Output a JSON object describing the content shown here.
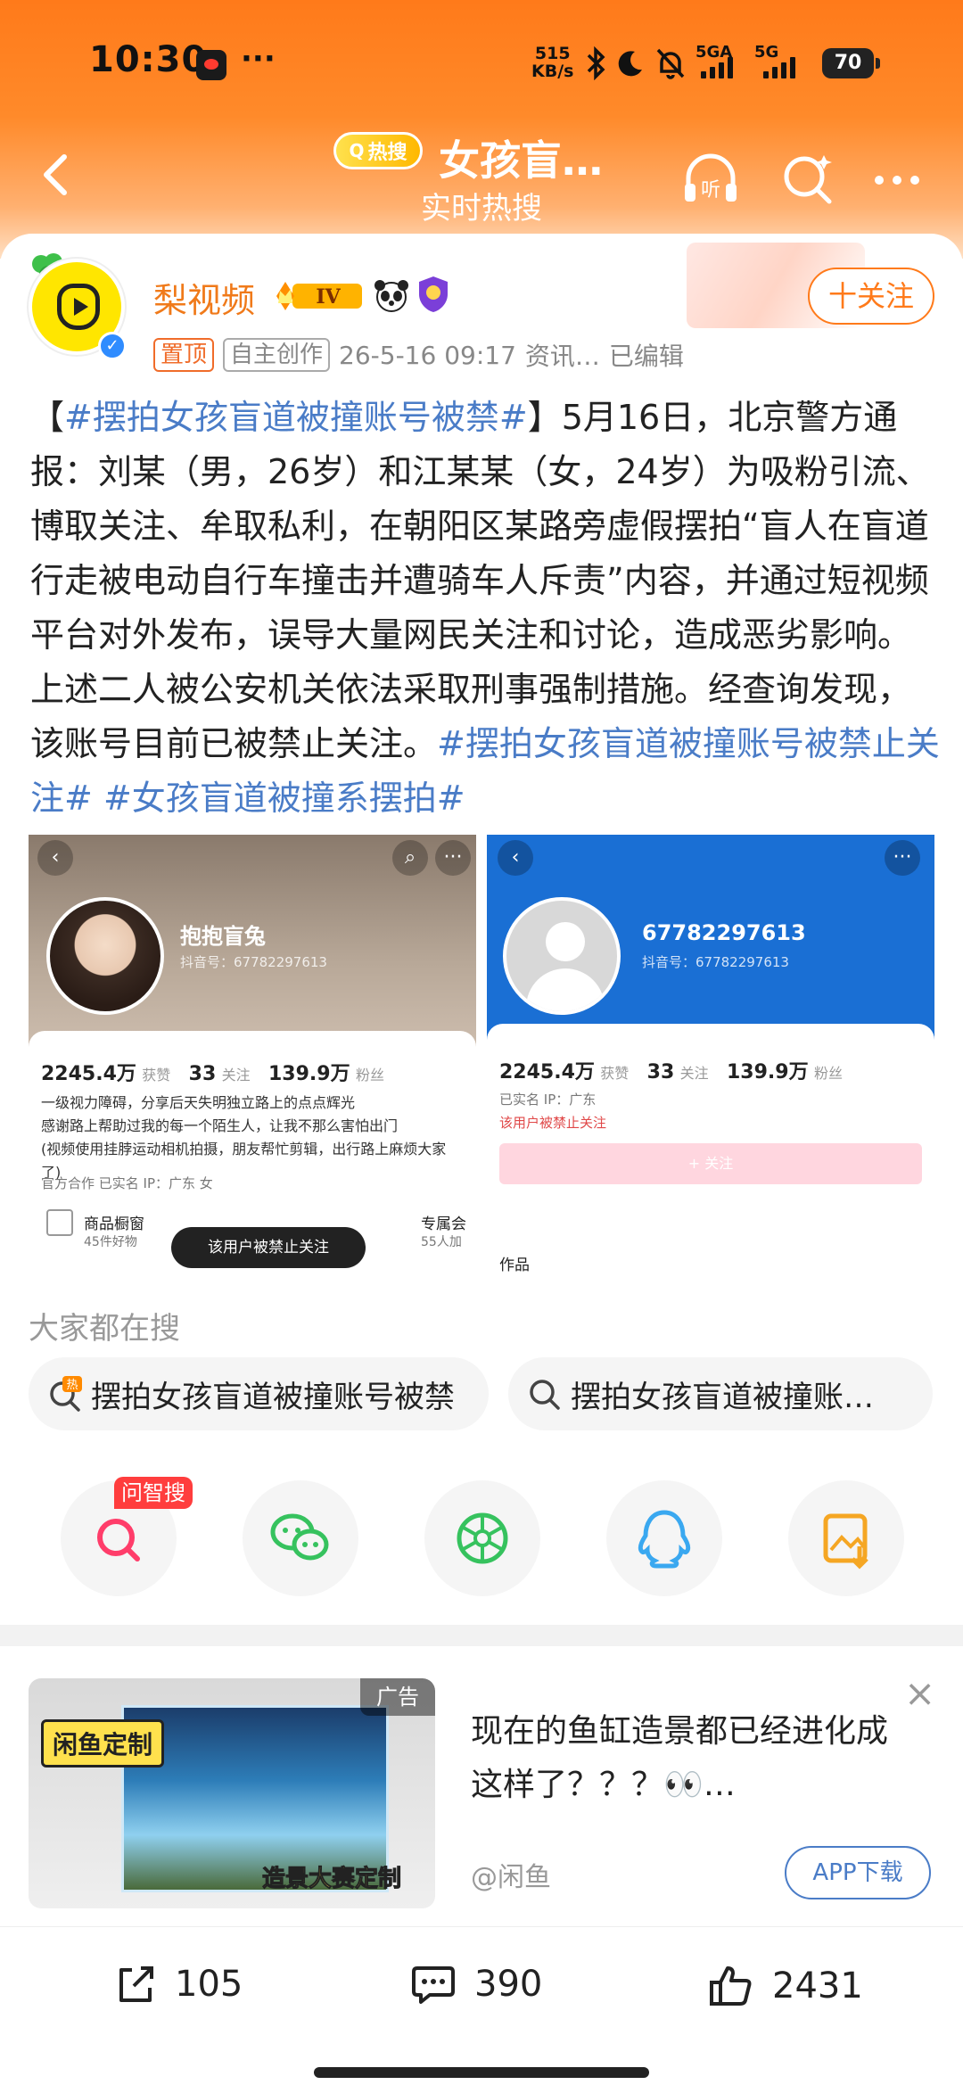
{
  "status_bar": {
    "time": "10:30",
    "more": "···",
    "net_speed_value": "515",
    "net_speed_unit": "KB/s",
    "sim1": "5GA",
    "sim2": "5G",
    "battery": "70"
  },
  "nav": {
    "hot_badge": "热搜",
    "title": "女孩盲…",
    "subtitle": "实时热搜",
    "listen_label": "听"
  },
  "author": {
    "name": "梨视频",
    "level": "IV",
    "tag_top": "置顶",
    "tag_original": "自主创作",
    "time": "26-5-16 09:17",
    "source": "资讯…",
    "edited": "已编辑",
    "follow_label": "十关注"
  },
  "post": {
    "segments": [
      {
        "text": "【",
        "tag": false
      },
      {
        "text": "#摆拍女孩盲道被撞账号被禁#",
        "tag": true
      },
      {
        "text": "】5月16日，北京警方通报：刘某（男，26岁）和江某某（女，24岁）为吸粉引流、博取关注、牟取私利，在朝阳区某路旁虚假摆拍“盲人在盲道行走被电动自行车撞击并遭骑车人斥责”内容，并通过短视频平台对外发布，误导大量网民关注和讨论，造成恶劣影响。上述二人被公安机关依法采取刑事强制措施。经查询发现，该账号目前已被禁止关注。",
        "tag": false
      },
      {
        "text": "#摆拍女孩盲道被撞账号被禁止关注#",
        "tag": true
      },
      {
        "text": " ",
        "tag": false
      },
      {
        "text": "#女孩盲道被撞系摆拍#",
        "tag": true
      }
    ]
  },
  "images": {
    "left": {
      "name": "抱抱盲兔",
      "id": "抖音号：67782297613",
      "likes_num": "2245.4万",
      "likes_label": "获赞",
      "following_num": "33",
      "following_label": "关注",
      "fans_num": "139.9万",
      "fans_label": "粉丝",
      "bio": "一级视力障碍，分享后天失明独立路上的点点辉光\n感谢路上帮助过我的每一个陌生人，让我不那么害怕出门\n(视频使用挂脖运动相机拍摄，朋友帮忙剪辑，出行路上麻烦大家了)",
      "meta": "官方合作   已实名   IP：广东   女",
      "shop_label": "商品橱窗",
      "shop_sub": "45件好物",
      "toast": "该用户被禁止关注",
      "vip_label": "专属会",
      "vip_sub": "55人加"
    },
    "right": {
      "name": "67782297613",
      "id": "抖音号：67782297613",
      "likes_num": "2245.4万",
      "likes_label": "获赞",
      "following_num": "33",
      "following_label": "关注",
      "fans_num": "139.9万",
      "fans_label": "粉丝",
      "meta": "已实名   IP：广东",
      "banned": "该用户被禁止关注",
      "follow_btn": "+ 关注",
      "works": "作品"
    }
  },
  "search": {
    "heading": "大家都在搜",
    "items": [
      {
        "label": "摆拍女孩盲道被撞账号被禁",
        "hot_mark": "热"
      },
      {
        "label": "摆拍女孩盲道被撞账…"
      }
    ]
  },
  "share": {
    "wenzhi_label": "问智搜"
  },
  "ad": {
    "badge": "广告",
    "left_tag": "闲鱼定制",
    "bottom_tag": "造景大赛定制",
    "title": "现在的鱼缸造景都已经进化成这样了？？？👀…",
    "source": "@闲鱼",
    "download": "APP下载",
    "close": "×"
  },
  "bottom_bar": {
    "share_count": "105",
    "comment_count": "390",
    "like_count": "2431"
  },
  "colors": {
    "accent": "#ff7a1a",
    "link": "#4a7cc7",
    "tag_red": "#f06c2a"
  }
}
